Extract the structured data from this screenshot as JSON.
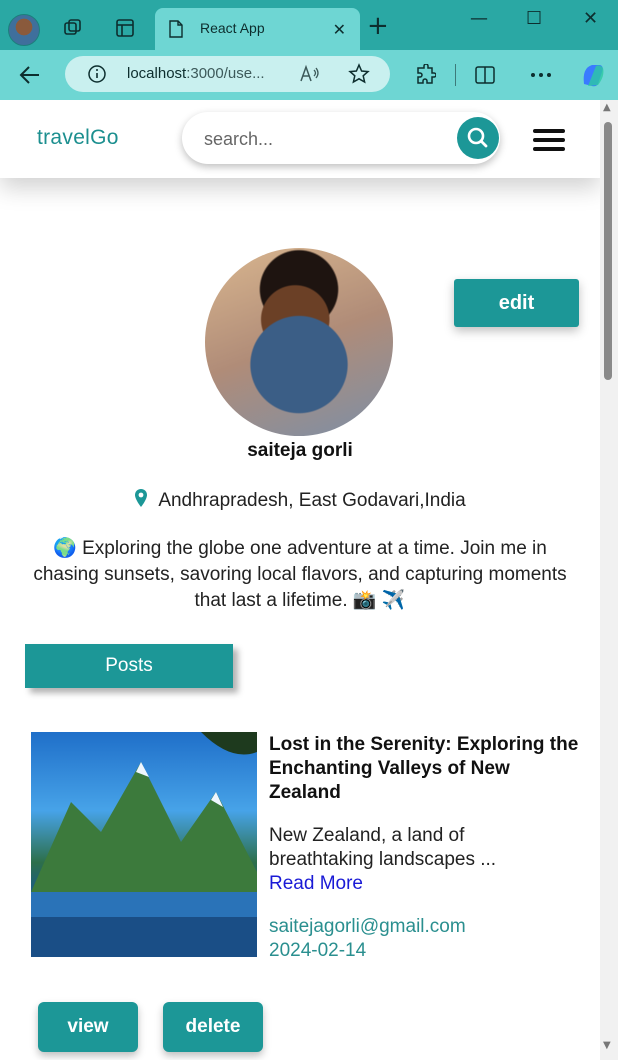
{
  "browser": {
    "tab_title": "React App",
    "url_host": "localhost",
    "url_rest": ":3000/use...",
    "new_tab_label": "+",
    "close_tab_label": "✕",
    "minimize_label": "—",
    "maximize_label": "☐",
    "close_window_label": "✕"
  },
  "header": {
    "brand": "travelGo",
    "search_placeholder": "search..."
  },
  "profile": {
    "edit_label": "edit",
    "name": "saiteja gorli",
    "location": "Andhrapradesh, East Godavari,India",
    "bio": "🌍 Exploring the globe one adventure at a time. Join me in chasing sunsets, savoring local flavors, and capturing moments that last a lifetime. 📸 ✈️"
  },
  "posts": {
    "tab_label": "Posts",
    "items": [
      {
        "title": "Lost in the Serenity: Exploring the Enchanting Valleys of New Zealand",
        "excerpt": "New Zealand, a land of breathtaking landscapes ...",
        "read_more": "Read More",
        "author_email": "saitejagorli@gmail.com",
        "date": "2024-02-14",
        "view_label": "view",
        "delete_label": "delete"
      }
    ]
  },
  "colors": {
    "accent": "#1c9797",
    "browser_tab": "#2aa8a4",
    "browser_nav": "#6ed6d3",
    "link": "#1a1ad6",
    "meta_text": "#2a8f8f"
  },
  "icons": [
    "profile-avatar-icon",
    "workspaces-icon",
    "tab-actions-icon",
    "page-icon",
    "back-arrow-icon",
    "info-icon",
    "read-aloud-icon",
    "favorite-star-icon",
    "extensions-icon",
    "split-screen-icon",
    "more-options-icon",
    "copilot-icon",
    "search-icon",
    "hamburger-menu-icon",
    "location-pin-icon"
  ]
}
